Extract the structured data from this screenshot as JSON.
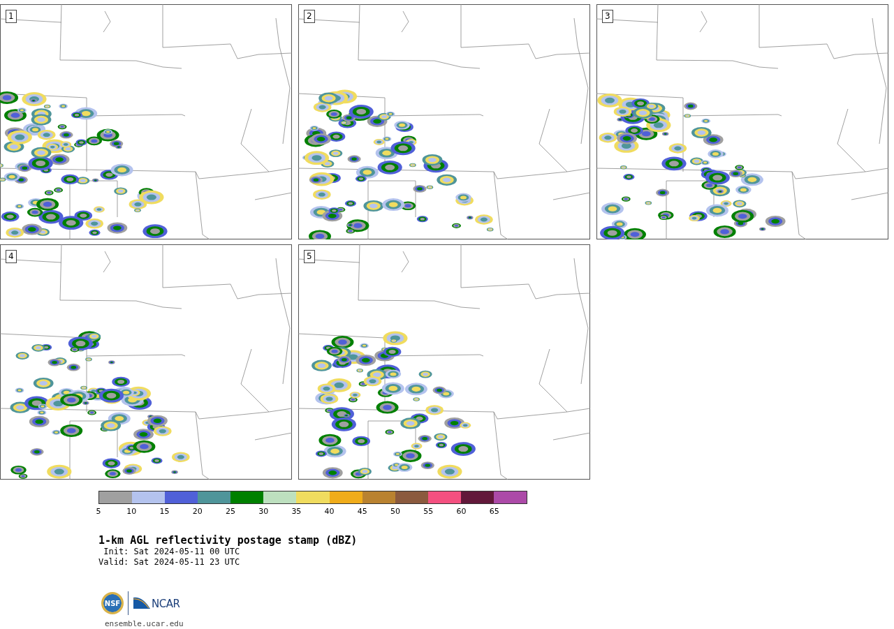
{
  "panels": [
    {
      "number": "1"
    },
    {
      "number": "2"
    },
    {
      "number": "3"
    },
    {
      "number": "4"
    },
    {
      "number": "5"
    }
  ],
  "colorbar": {
    "bins": [
      {
        "color": "#a0a0a0",
        "label": "5"
      },
      {
        "color": "#b4c3ee",
        "label": "10"
      },
      {
        "color": "#5060d8",
        "label": "15"
      },
      {
        "color": "#4f959a",
        "label": "20"
      },
      {
        "color": "#008000",
        "label": "25"
      },
      {
        "color": "#bde0bf",
        "label": "30"
      },
      {
        "color": "#f0dc5f",
        "label": "35"
      },
      {
        "color": "#f0ac1a",
        "label": "40"
      },
      {
        "color": "#b98230",
        "label": "45"
      },
      {
        "color": "#8b5a3e",
        "label": "50"
      },
      {
        "color": "#f45080",
        "label": "55"
      },
      {
        "color": "#62183a",
        "label": "60"
      },
      {
        "color": "#ac4aa8",
        "label": "65"
      }
    ]
  },
  "title": "1-km AGL reflectivity postage stamp (dBZ)",
  "init": "Init: Sat 2024-05-11 00 UTC",
  "valid": "Valid: Sat 2024-05-11 23 UTC",
  "logos": {
    "nsf": "NSF",
    "ncar": "NCAR"
  },
  "url": "ensemble.ucar.edu"
}
